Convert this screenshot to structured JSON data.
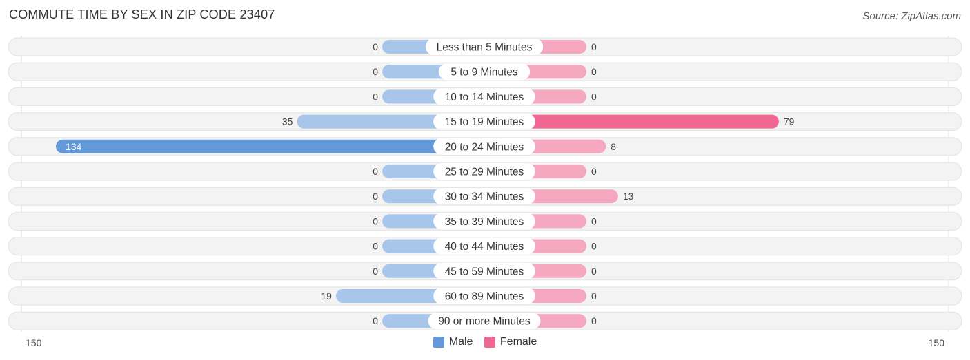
{
  "title": "COMMUTE TIME BY SEX IN ZIP CODE 23407",
  "source": "Source: ZipAtlas.com",
  "colors": {
    "male": "#a8c6ea",
    "male_strong": "#6399d8",
    "female": "#f6a8c0",
    "female_strong": "#f06892",
    "row_bg": "#f3f3f3"
  },
  "legend": {
    "male": "Male",
    "female": "Female"
  },
  "axis": {
    "left_label": "150",
    "right_label": "150"
  },
  "chart_data": {
    "type": "bar",
    "orientation": "horizontal-diverging",
    "title": "COMMUTE TIME BY SEX IN ZIP CODE 23407",
    "categories": [
      "Less than 5 Minutes",
      "5 to 9 Minutes",
      "10 to 14 Minutes",
      "15 to 19 Minutes",
      "20 to 24 Minutes",
      "25 to 29 Minutes",
      "30 to 34 Minutes",
      "35 to 39 Minutes",
      "40 to 44 Minutes",
      "45 to 59 Minutes",
      "60 to 89 Minutes",
      "90 or more Minutes"
    ],
    "series": [
      {
        "name": "Male",
        "values": [
          0,
          0,
          0,
          35,
          134,
          0,
          0,
          0,
          0,
          0,
          19,
          0
        ]
      },
      {
        "name": "Female",
        "values": [
          0,
          0,
          0,
          79,
          8,
          0,
          13,
          0,
          0,
          0,
          0,
          0
        ]
      }
    ],
    "xlim": [
      -150,
      150
    ],
    "legend": "bottom-center"
  }
}
